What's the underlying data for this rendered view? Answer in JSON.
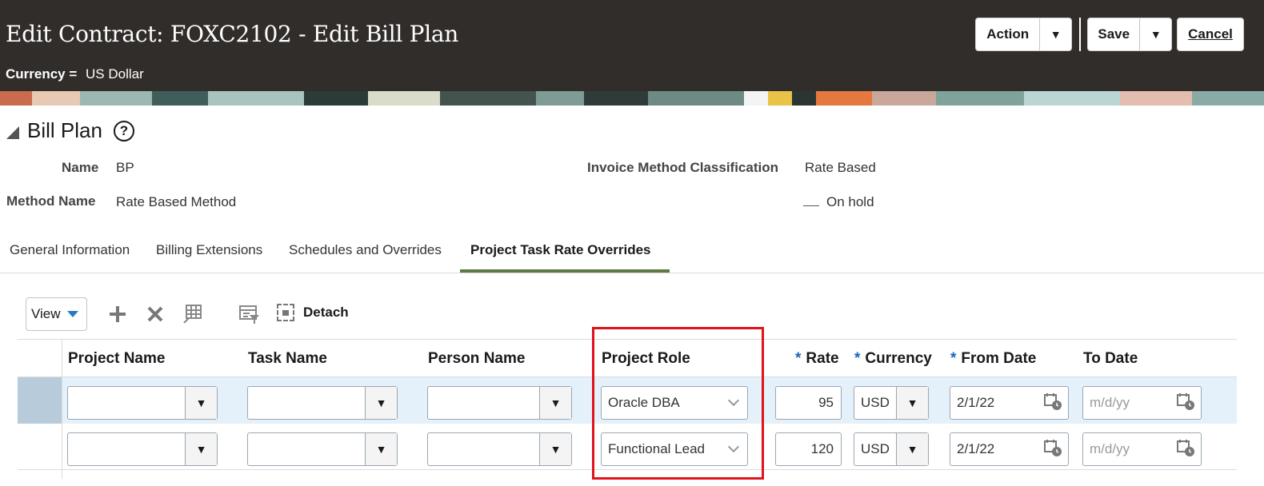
{
  "header": {
    "title": "Edit Contract: FOXC2102 - Edit Bill Plan",
    "currency_label": "Currency =",
    "currency_value": "US Dollar",
    "action_label": "Action",
    "save_label": "Save",
    "cancel_label": "Cancel"
  },
  "bill_plan": {
    "title": "Bill Plan",
    "help": "?",
    "name_label": "Name",
    "name_value": "BP",
    "method_label": "Method Name",
    "method_value": "Rate Based Method",
    "classification_label": "Invoice Method Classification",
    "classification_value": "Rate Based",
    "on_hold_label": "On hold"
  },
  "tabs": [
    {
      "label": "General Information"
    },
    {
      "label": "Billing Extensions"
    },
    {
      "label": "Schedules and Overrides"
    },
    {
      "label": "Project Task Rate Overrides"
    }
  ],
  "toolbar": {
    "view_label": "View",
    "detach_label": "Detach"
  },
  "table": {
    "columns": {
      "project_name": "Project Name",
      "task_name": "Task Name",
      "person_name": "Person Name",
      "project_role": "Project Role",
      "rate": "Rate",
      "currency": "Currency",
      "from_date": "From Date",
      "to_date": "To Date",
      "required_mark": "*"
    },
    "rows": [
      {
        "project_role": "Oracle DBA",
        "rate": "95",
        "currency": "USD",
        "from_date": "2/1/22",
        "to_date_placeholder": "m/d/yy",
        "selected": true
      },
      {
        "project_role": "Functional Lead",
        "rate": "120",
        "currency": "USD",
        "from_date": "2/1/22",
        "to_date_placeholder": "m/d/yy",
        "selected": false
      }
    ]
  },
  "colors": {
    "header_bg": "#312d2a",
    "active_tab_underline": "#5b7a44",
    "required_star": "#1c63b8",
    "highlight_box": "#e0121b",
    "selected_row": "#e4f1fb"
  }
}
